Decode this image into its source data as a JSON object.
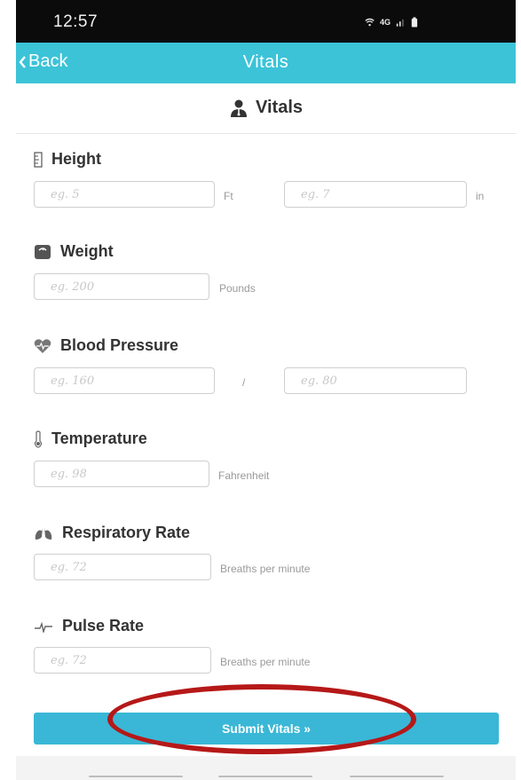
{
  "status_bar": {
    "time": "12:57",
    "network_label": "4G"
  },
  "nav": {
    "back_label": "Back",
    "title": "Vitals"
  },
  "header": {
    "title": "Vitals"
  },
  "sections": {
    "height": {
      "label": "Height",
      "ft_placeholder": "eg. 5",
      "ft_unit": "Ft",
      "in_placeholder": "eg. 7",
      "in_unit": "in"
    },
    "weight": {
      "label": "Weight",
      "placeholder": "eg. 200",
      "unit": "Pounds"
    },
    "blood_pressure": {
      "label": "Blood Pressure",
      "systolic_placeholder": "eg. 160",
      "separator": "/",
      "diastolic_placeholder": "eg. 80"
    },
    "temperature": {
      "label": "Temperature",
      "placeholder": "eg. 98",
      "unit": "Fahrenheit"
    },
    "respiratory_rate": {
      "label": "Respiratory Rate",
      "placeholder": "eg. 72",
      "unit": "Breaths per minute"
    },
    "pulse_rate": {
      "label": "Pulse Rate",
      "placeholder": "eg. 72",
      "unit": "Breaths per minute"
    }
  },
  "submit": {
    "label": "Submit Vitals »"
  },
  "colors": {
    "nav": "#3cc3d8",
    "submit": "#3ab7d6",
    "highlight": "#b61818"
  }
}
